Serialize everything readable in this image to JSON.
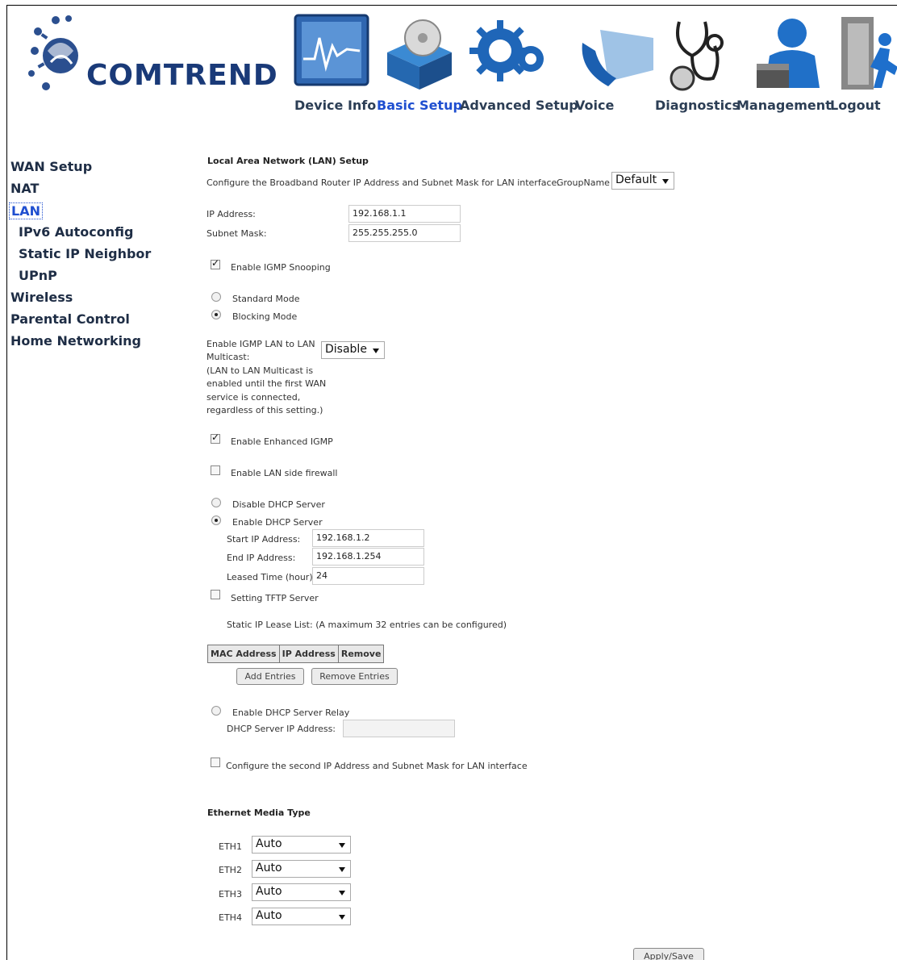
{
  "brand": "COMTREND",
  "nav": [
    {
      "label": "Device Info"
    },
    {
      "label": "Basic Setup"
    },
    {
      "label": "Advanced Setup"
    },
    {
      "label": "Voice"
    },
    {
      "label": "Diagnostics"
    },
    {
      "label": "Management"
    },
    {
      "label": "Logout"
    }
  ],
  "sidebar": [
    {
      "label": "WAN Setup"
    },
    {
      "label": "NAT"
    },
    {
      "label": "LAN"
    },
    {
      "label": "IPv6 Autoconfig"
    },
    {
      "label": "Static IP Neighbor"
    },
    {
      "label": "UPnP"
    },
    {
      "label": "Wireless"
    },
    {
      "label": "Parental Control"
    },
    {
      "label": "Home Networking"
    }
  ],
  "lan": {
    "title": "Local Area Network (LAN) Setup",
    "intro": "Configure the Broadband Router IP Address and Subnet Mask for LAN interface.",
    "group_label": "GroupName",
    "group_value": "Default",
    "ip_label": "IP Address:",
    "ip_value": "192.168.1.1",
    "mask_label": "Subnet Mask:",
    "mask_value": "255.255.255.0",
    "igmp_snooping": "Enable IGMP Snooping",
    "standard_mode": "Standard Mode",
    "blocking_mode": "Blocking Mode",
    "lan_multicast_label_1": "Enable IGMP LAN to LAN",
    "lan_multicast_label_2": "Multicast:",
    "lan_multicast_value": "Disable",
    "lan_multicast_note_1": "(LAN to LAN Multicast is",
    "lan_multicast_note_2": "enabled until the first WAN",
    "lan_multicast_note_3": "service is connected,",
    "lan_multicast_note_4": "regardless of this setting.)",
    "enhanced_igmp": "Enable Enhanced IGMP",
    "lan_firewall": "Enable LAN side firewall",
    "disable_dhcp": "Disable DHCP Server",
    "enable_dhcp": "Enable DHCP Server",
    "start_ip_label": "Start IP Address:",
    "start_ip_value": "192.168.1.2",
    "end_ip_label": "End IP Address:",
    "end_ip_value": "192.168.1.254",
    "lease_label": "Leased Time (hour):",
    "lease_value": "24",
    "tftp": "Setting TFTP Server",
    "static_lease_note": "Static IP Lease List: (A maximum 32 entries can be configured)",
    "lease_headers": [
      "MAC Address",
      "IP Address",
      "Remove"
    ],
    "add_entries": "Add Entries",
    "remove_entries": "Remove Entries",
    "relay": "Enable DHCP Server Relay",
    "relay_ip_label": "DHCP Server IP Address:",
    "relay_ip_value": "",
    "second_ip": "Configure the second IP Address and Subnet Mask for LAN interface",
    "eth_title": "Ethernet Media Type",
    "eth": [
      {
        "label": "ETH1",
        "value": "Auto"
      },
      {
        "label": "ETH2",
        "value": "Auto"
      },
      {
        "label": "ETH3",
        "value": "Auto"
      },
      {
        "label": "ETH4",
        "value": "Auto"
      }
    ],
    "apply": "Apply/Save"
  }
}
